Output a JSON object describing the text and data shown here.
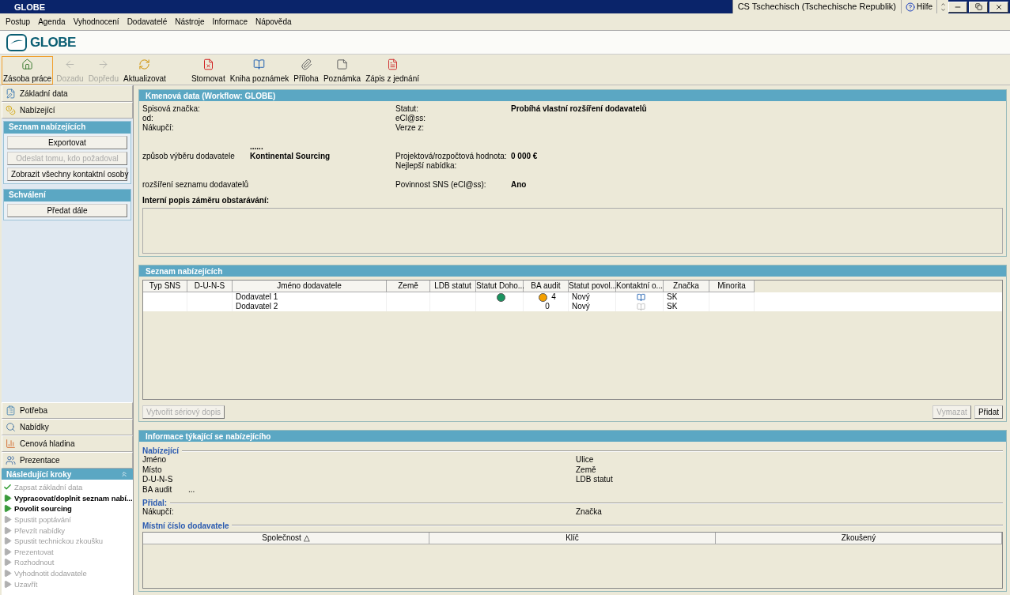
{
  "window": {
    "title": "GLOBE",
    "language": "CS Tschechisch (Tschechische Republik)",
    "help": "Hilfe"
  },
  "menu": [
    "Postup",
    "Agenda",
    "Vyhodnocení",
    "Dodavatelé",
    "Nástroje",
    "Informace",
    "Nápověda"
  ],
  "logo": "GLOBE",
  "toolbar": [
    [
      {
        "label": "Zásoba práce",
        "selected": true,
        "disabled": false
      },
      {
        "label": "Dozadu",
        "selected": false,
        "disabled": true
      },
      {
        "label": "Dopředu",
        "selected": false,
        "disabled": true
      },
      {
        "label": "Aktualizovat",
        "selected": false,
        "disabled": false
      }
    ],
    [
      {
        "label": "Stornovat",
        "selected": false,
        "disabled": false
      },
      {
        "label": "Kniha poznámek",
        "selected": false,
        "disabled": false
      },
      {
        "label": "Příloha",
        "selected": false,
        "disabled": false
      },
      {
        "label": "Poznámka",
        "selected": false,
        "disabled": false
      },
      {
        "label": "Zápis z jednání",
        "selected": false,
        "disabled": false
      }
    ]
  ],
  "sidebar": {
    "top_items": [
      {
        "label": "Základní data"
      },
      {
        "label": "Nabízející"
      }
    ],
    "sections": [
      {
        "title": "Seznam nabízejících",
        "buttons": [
          {
            "label": "Exportovat",
            "disabled": false
          },
          {
            "label": "Odeslat tomu, kdo požadoval",
            "disabled": true
          },
          {
            "label": "Zobrazit všechny kontaktní osoby",
            "disabled": false
          }
        ]
      },
      {
        "title": "Schválení",
        "buttons": [
          {
            "label": "Předat dále",
            "disabled": false
          }
        ]
      }
    ],
    "bottom_items": [
      {
        "label": "Potřeba"
      },
      {
        "label": "Nabídky"
      },
      {
        "label": "Cenová hladina"
      },
      {
        "label": "Prezentace"
      }
    ],
    "steps_title": "Následující kroky",
    "steps": [
      {
        "label": "Zapsat základní data",
        "kind": "done"
      },
      {
        "label": "Vypracovat/doplnit seznam nabí...",
        "kind": "active"
      },
      {
        "label": "Povolit sourcing",
        "kind": "active"
      },
      {
        "label": "Spustit poptávání",
        "kind": "pending"
      },
      {
        "label": "Převzít nabídky",
        "kind": "pending"
      },
      {
        "label": "Spustit technickou zkoušku",
        "kind": "pending"
      },
      {
        "label": "Prezentovat",
        "kind": "pending"
      },
      {
        "label": "Rozhodnout",
        "kind": "pending"
      },
      {
        "label": "Vyhodnotit dodavatele",
        "kind": "pending"
      },
      {
        "label": "Uzavřít",
        "kind": "pending"
      }
    ]
  },
  "master_data": {
    "title": "Kmenová data (Workflow: GLOBE)",
    "field_groups": [
      [
        {
          "left_label": "Spisová značka:",
          "right_label": "Statut:",
          "right_value": "Probíhá vlastní rozšíření dodavatelů"
        },
        {
          "left_label": "od:",
          "right_label": "eCl@ss:"
        },
        {
          "left_label": "Nákupčí:",
          "right_label": "Verze z:"
        }
      ],
      [
        {
          "left_value": "......"
        },
        {
          "left_label": "způsob výběru dodavatele",
          "left_value": "Kontinental Sourcing",
          "right_label": "Projektová/rozpočtová hodnota:",
          "right_value": "0 000 €"
        },
        {
          "right_label": "Nejlepší nabídka:"
        }
      ],
      [
        {
          "left_label": "rozšíření seznamu dodavatelů",
          "right_label": "Povinnost SNS (eCl@ss):",
          "right_value": "Ano"
        }
      ]
    ],
    "description_label": "Interní popis záměru obstarávání:"
  },
  "bidders": {
    "title": "Seznam nabízejících",
    "columns": [
      "Typ SNS",
      "D-U-N-S",
      "Jméno dodavatele",
      "Země",
      "LDB statut",
      "Statut Doho...",
      "BA audit",
      "Statut povol...",
      "Kontaktní o...",
      "Značka",
      "Minorita"
    ],
    "rows": [
      {
        "name": "Dodavatel 1",
        "agreement_dot": {
          "color": "#1a9460"
        },
        "audit_dot": {
          "color": "#f5a000"
        },
        "ba_audit": "4",
        "status": "Nový",
        "contact_active": true,
        "brand": "SK"
      },
      {
        "name": "Dodavatel 2",
        "ba_audit": "0",
        "status": "Nový",
        "contact_active": false,
        "brand": "SK"
      }
    ],
    "left_button": {
      "label": "Vytvořit sériový dopis",
      "disabled": true
    },
    "right_buttons": [
      {
        "label": "Vymazat",
        "disabled": true
      },
      {
        "label": "Přidat",
        "disabled": false
      }
    ]
  },
  "bidder_info": {
    "title": "Informace týkající se nabízejícího",
    "groups": [
      {
        "title": "Nabízející",
        "left": [
          {
            "label": "Jméno"
          },
          {
            "label": "Místo"
          },
          {
            "label": "D-U-N-S"
          },
          {
            "label": "BA audit",
            "value": "..."
          }
        ],
        "right": [
          {
            "label": "Ulice"
          },
          {
            "label": "Země"
          },
          {
            "label": "LDB statut"
          }
        ]
      },
      {
        "title": "Přidal:",
        "left": [
          {
            "label": "Nákupčí:"
          }
        ],
        "right": [
          {
            "label": "Značka"
          }
        ]
      }
    ],
    "supplier_numbers": {
      "title": "Místní číslo dodavatele",
      "columns": [
        "Společnost △",
        "Klíč",
        "Zkoušený"
      ]
    }
  }
}
